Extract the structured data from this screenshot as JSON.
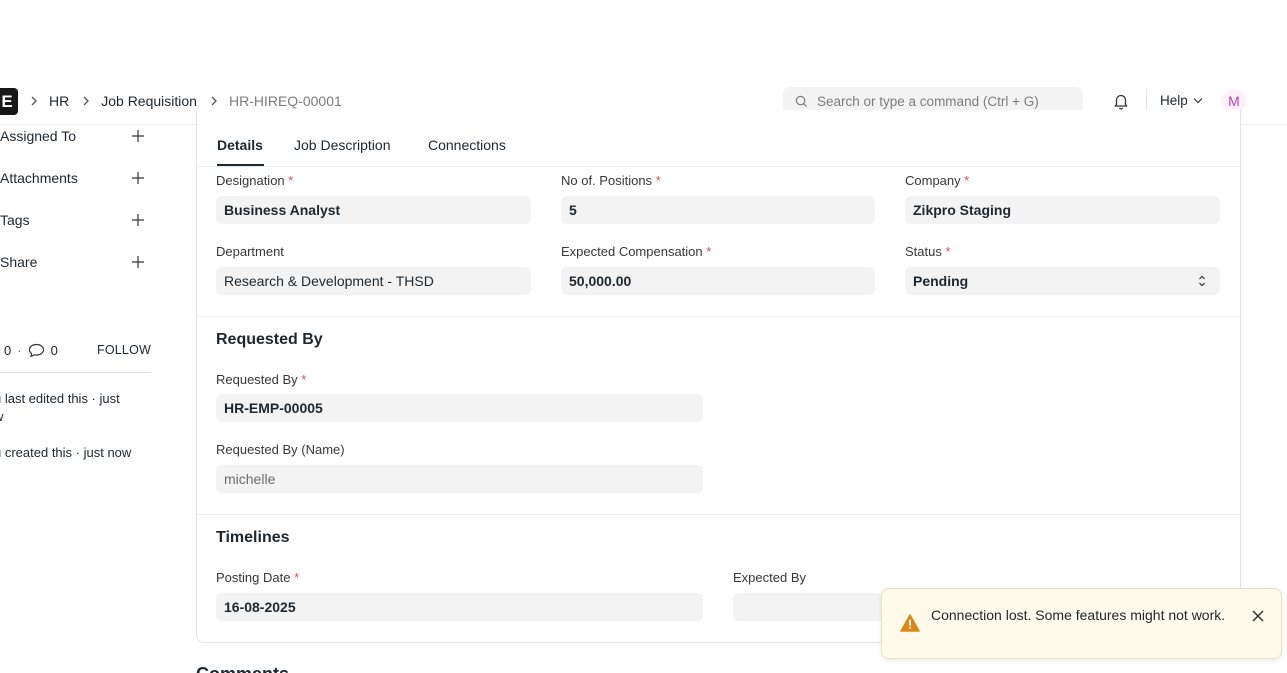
{
  "navbar": {
    "logo_letter": "E",
    "breadcrumbs": [
      "HR",
      "Job Requisition",
      "HR-HIREQ-00001"
    ],
    "search_placeholder": "Search or type a command (Ctrl + G)",
    "help_label": "Help",
    "avatar_initial": "M"
  },
  "sidebar": {
    "items": [
      {
        "label": "Assigned To"
      },
      {
        "label": "Attachments"
      },
      {
        "label": "Tags"
      },
      {
        "label": "Share"
      }
    ],
    "likes": "0",
    "comments": "0",
    "follow_label": "FOLLOW",
    "activity": [
      "u last edited this · just",
      "w",
      "u created this · just now"
    ]
  },
  "tabs": [
    "Details",
    "Job Description",
    "Connections"
  ],
  "form": {
    "designation": {
      "label": "Designation",
      "value": "Business Analyst"
    },
    "positions": {
      "label": "No of. Positions",
      "value": "5"
    },
    "company": {
      "label": "Company",
      "value": "Zikpro Staging"
    },
    "department": {
      "label": "Department",
      "value": "Research & Development - THSD"
    },
    "compensation": {
      "label": "Expected Compensation",
      "value": "50,000.00"
    },
    "status": {
      "label": "Status",
      "value": "Pending"
    }
  },
  "requested_section": {
    "title": "Requested By",
    "requested_by": {
      "label": "Requested By",
      "value": "HR-EMP-00005"
    },
    "requested_by_name": {
      "label": "Requested By (Name)",
      "value": "michelle"
    }
  },
  "timelines_section": {
    "title": "Timelines",
    "posting_date": {
      "label": "Posting Date",
      "value": "16-08-2025"
    },
    "expected_by": {
      "label": "Expected By",
      "value": ""
    }
  },
  "comments_title": "Comments",
  "toast": {
    "message": "Connection lost. Some features might not work."
  },
  "colors": {
    "required": "#e24c4c",
    "toast_bg": "#fffbeb",
    "warning": "#d9881a",
    "avatar": "#c03ec2"
  }
}
